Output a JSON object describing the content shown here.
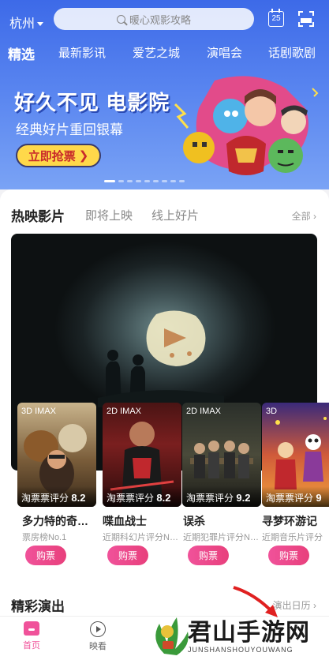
{
  "header": {
    "city": "杭州",
    "search_placeholder": "暖心观影攻略",
    "calendar_day": "25"
  },
  "categories": [
    {
      "label": "精选",
      "active": true
    },
    {
      "label": "最新影讯"
    },
    {
      "label": "爱艺之城"
    },
    {
      "label": "演唱会"
    },
    {
      "label": "话剧歌剧"
    }
  ],
  "banner": {
    "headline": "好久不见 电影院",
    "subline": "经典好片重回银幕",
    "button_label": "立即抢票"
  },
  "movies_section": {
    "tabs": [
      "热映影片",
      "即将上映",
      "线上好片"
    ],
    "all_label": "全部"
  },
  "movies": [
    {
      "format": "3D IMAX",
      "score_label": "淘票票评分",
      "score": "8.2",
      "title": "多力特的奇…",
      "subtitle": "票房榜No.1",
      "buy_label": "购票"
    },
    {
      "format": "2D IMAX",
      "score_label": "淘票票评分",
      "score": "8.2",
      "title": "喋血战士",
      "subtitle": "近期科幻片评分N…",
      "buy_label": "购票"
    },
    {
      "format": "2D IMAX",
      "score_label": "淘票票评分",
      "score": "9.2",
      "title": "误杀",
      "subtitle": "近期犯罪片评分N…",
      "buy_label": "购票"
    },
    {
      "format": "3D",
      "score_label": "淘票票评分",
      "score": "9",
      "title": "寻梦环游记",
      "subtitle": "近期音乐片评分",
      "buy_label": "购票"
    }
  ],
  "shows_section": {
    "title": "精彩演出",
    "link_label": "演出日历"
  },
  "bottom_nav": [
    {
      "label": "首页",
      "icon": "home-icon",
      "active": true
    },
    {
      "label": "映看",
      "icon": "play-circle-icon"
    }
  ],
  "watermark": {
    "text": "君山手游网",
    "sub": "JUNSHANSHOUYOUWANG"
  },
  "colors": {
    "header_blue": "#3d6ae8",
    "accent_pink": "#f0529a",
    "button_yellow": "#ffd84a"
  }
}
